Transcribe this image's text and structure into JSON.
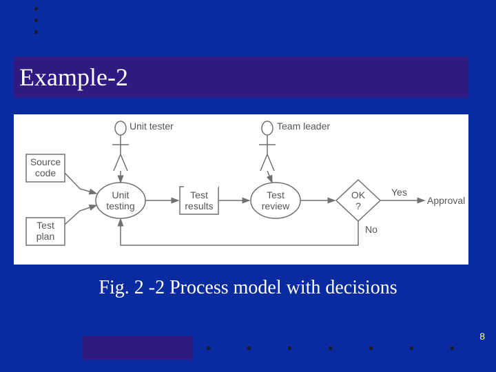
{
  "colors": {
    "background": "#0a2aa0",
    "title_bar": "#2e1a80",
    "diagram_line": "#707070",
    "diagram_text": "#555555",
    "page_number": "#ffff88",
    "caption_text": "#ffffff"
  },
  "title": "Example-2",
  "diagram": {
    "actors": [
      {
        "label": "Unit tester"
      },
      {
        "label": "Team leader"
      }
    ],
    "inputs": [
      {
        "label_line1": "Source",
        "label_line2": "code"
      },
      {
        "label_line1": "Test",
        "label_line2": "plan"
      }
    ],
    "activities": [
      {
        "label_line1": "Unit",
        "label_line2": "testing"
      },
      {
        "label_line1": "Test",
        "label_line2": "review"
      }
    ],
    "artifacts": [
      {
        "label_line1": "Test",
        "label_line2": "results"
      }
    ],
    "decision": {
      "label_line1": "OK",
      "label_line2": "?",
      "yes_label": "Yes",
      "no_label": "No"
    },
    "output": {
      "label": "Approval"
    }
  },
  "caption": "Fig. 2 -2 Process model with decisions",
  "page_number": "8"
}
